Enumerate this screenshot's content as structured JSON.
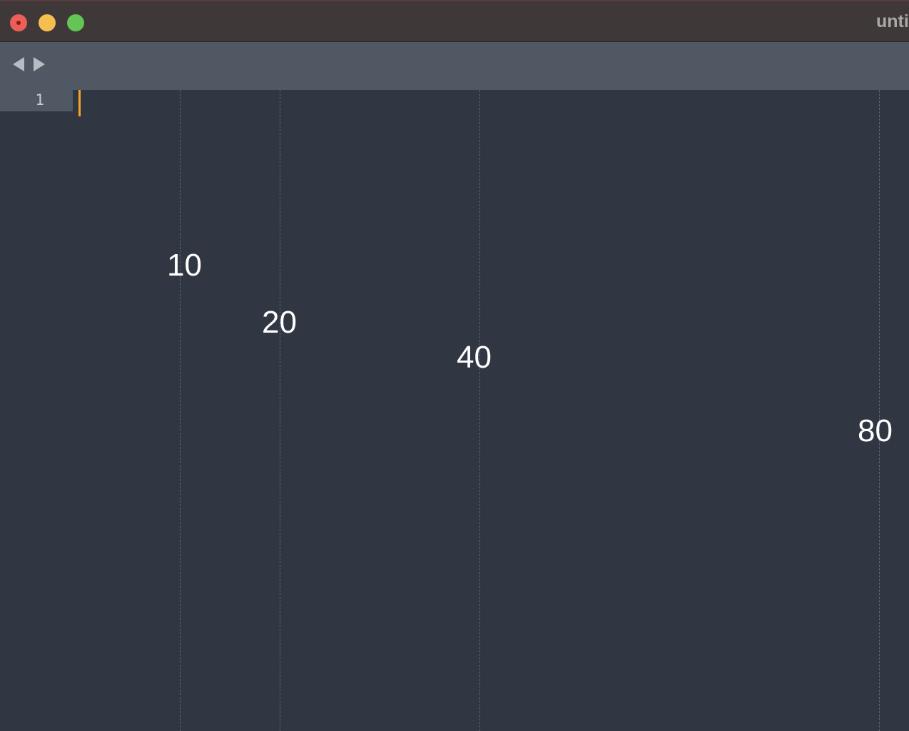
{
  "window": {
    "title": "unti",
    "controls": {
      "close": "close-icon",
      "minimize": "minimize-icon",
      "zoom": "zoom-icon"
    }
  },
  "toolbar": {
    "back_icon": "triangle-left-icon",
    "forward_icon": "triangle-right-icon"
  },
  "editor": {
    "line_numbers": [
      "1"
    ],
    "content": "",
    "rulers": [
      {
        "column": 10,
        "label": "10"
      },
      {
        "column": 20,
        "label": "20"
      },
      {
        "column": 40,
        "label": "40"
      },
      {
        "column": 80,
        "label": "80"
      }
    ]
  },
  "colors": {
    "background": "#303742",
    "tabbar": "#4f5863",
    "titlebar": "#3e3839",
    "caret": "#f5a623"
  }
}
